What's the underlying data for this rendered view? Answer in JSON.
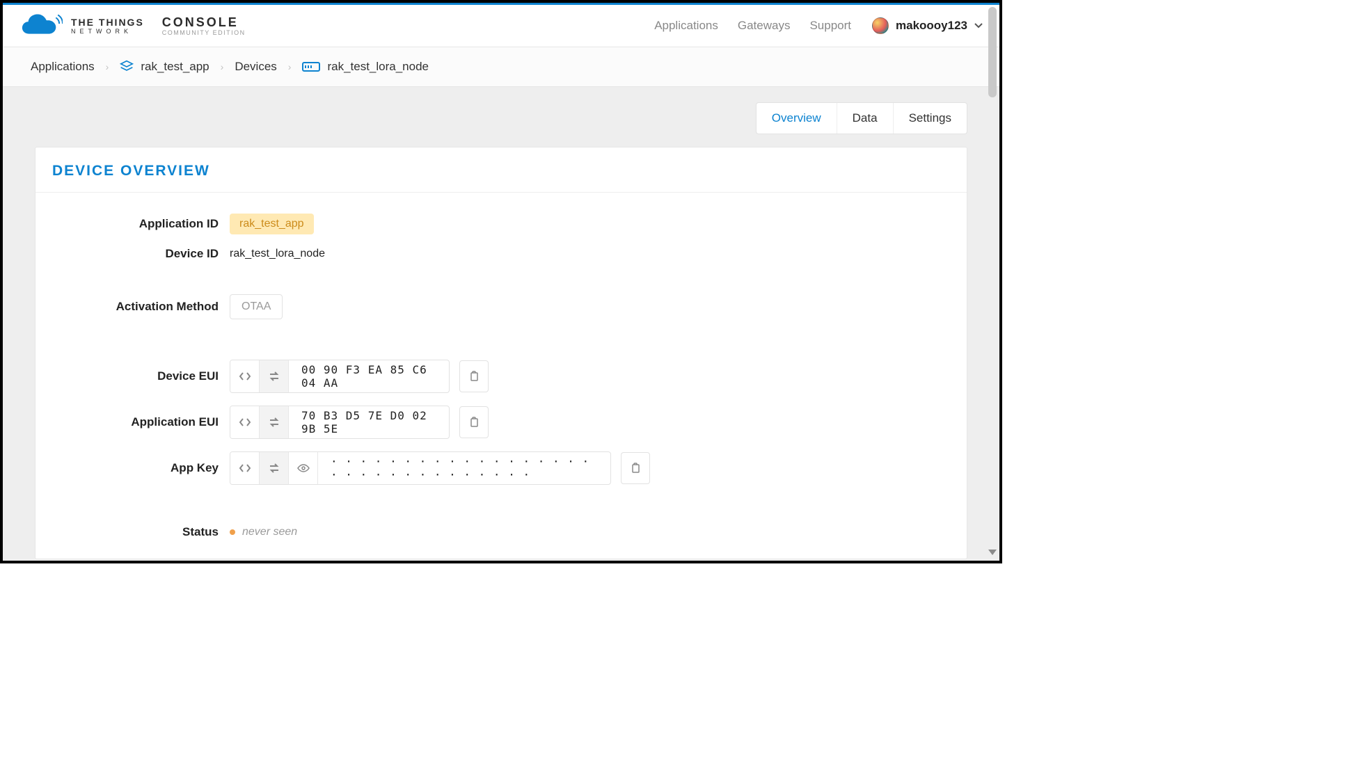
{
  "header": {
    "brand_line1": "THE THINGS",
    "brand_line2": "NETWORK",
    "console_line1": "CONSOLE",
    "console_line2": "COMMUNITY EDITION",
    "nav": {
      "applications": "Applications",
      "gateways": "Gateways",
      "support": "Support"
    },
    "username": "makoooy123"
  },
  "breadcrumb": {
    "applications": "Applications",
    "app": "rak_test_app",
    "devices": "Devices",
    "device": "rak_test_lora_node"
  },
  "tabs": {
    "overview": "Overview",
    "data": "Data",
    "settings": "Settings"
  },
  "card": {
    "title": "DEVICE OVERVIEW",
    "labels": {
      "application_id": "Application ID",
      "device_id": "Device ID",
      "activation_method": "Activation Method",
      "device_eui": "Device EUI",
      "application_eui": "Application EUI",
      "app_key": "App Key",
      "status": "Status"
    },
    "values": {
      "application_id": "rak_test_app",
      "device_id": "rak_test_lora_node",
      "activation_method": "OTAA",
      "device_eui": "00 90 F3 EA 85 C6 04 AA",
      "application_eui": "70 B3 D5 7E D0 02 9B 5E",
      "app_key_masked": "· · · · · · · · · · · · · · · · · · · · · · · · · · · · · · · ·",
      "status": "never seen"
    }
  }
}
